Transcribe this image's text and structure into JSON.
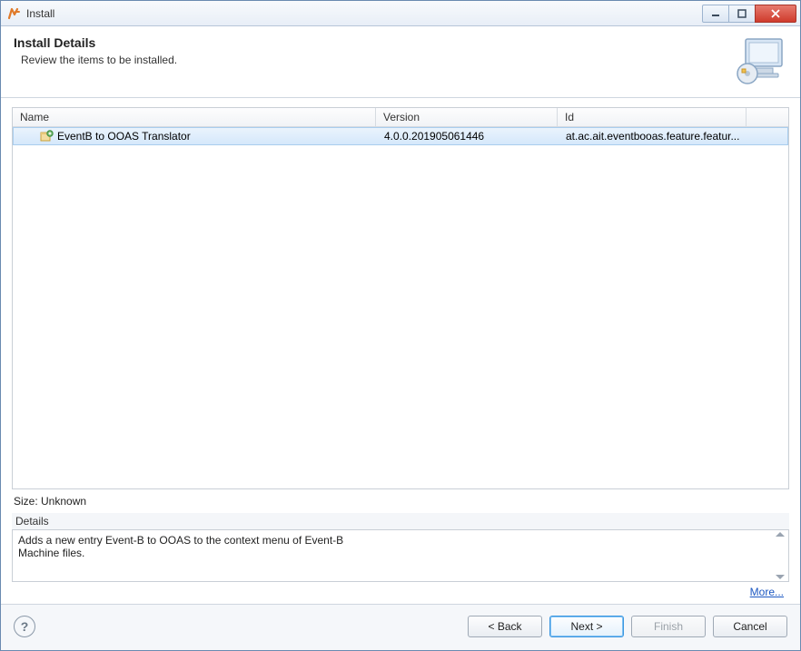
{
  "window": {
    "title": "Install"
  },
  "banner": {
    "title": "Install Details",
    "subtitle": "Review the items to be installed."
  },
  "table": {
    "headers": {
      "name": "Name",
      "version": "Version",
      "id": "Id"
    },
    "rows": [
      {
        "name": "EventB to OOAS Translator",
        "version": "4.0.0.201905061446",
        "id": "at.ac.ait.eventbooas.feature.featur..."
      }
    ]
  },
  "size_line": "Size: Unknown",
  "details": {
    "label": "Details",
    "text": "Adds a new entry Event-B to OOAS to the context menu of Event-B\nMachine files."
  },
  "more_link": "More...",
  "buttons": {
    "back": "< Back",
    "next": "Next >",
    "finish": "Finish",
    "cancel": "Cancel"
  }
}
